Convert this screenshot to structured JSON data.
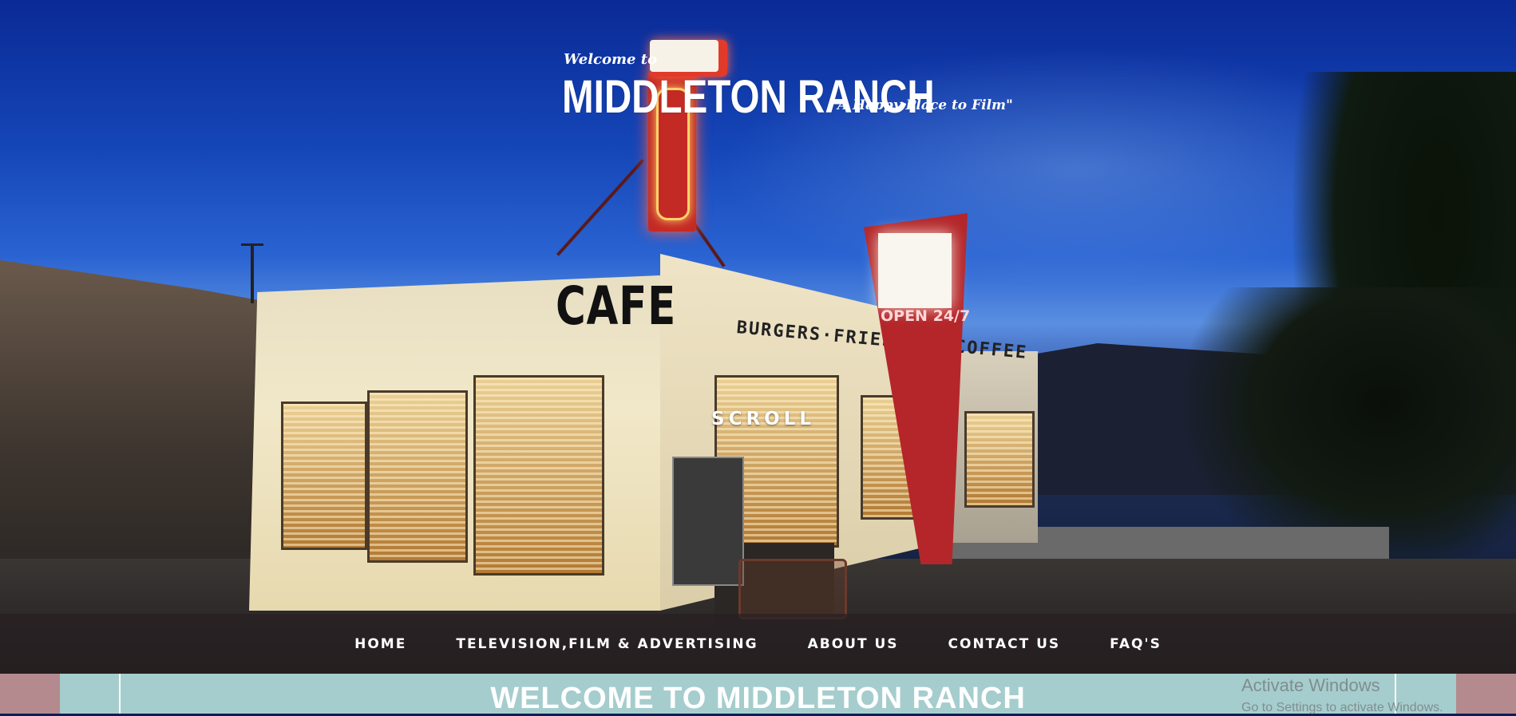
{
  "logo": {
    "welcome": "Welcome to",
    "title": "MIDDLETON RANCH",
    "tagline": "\"A Happy Place to Film\""
  },
  "scene": {
    "cafe_sign": "CAFE",
    "burger_sign": "BURGERS·FRIES·HOT COFFEE",
    "pylon_sign": "OPEN 24/7"
  },
  "scroll_label": "SCROLL",
  "nav": {
    "items": [
      "HOME",
      "TELEVISION,FILM & ADVERTISING",
      "ABOUT US",
      "CONTACT US",
      "FAQ'S"
    ]
  },
  "welcome_banner": "WELCOME TO MIDDLETON RANCH",
  "watermark": {
    "title": "Activate Windows",
    "subtitle": "Go to Settings to activate Windows."
  },
  "colors": {
    "sky": "#1546b8",
    "nav_overlay": "#282022",
    "strip": "#a6cdcd",
    "strip_accent": "#b48a8e",
    "neon_red": "#e23a2a"
  }
}
